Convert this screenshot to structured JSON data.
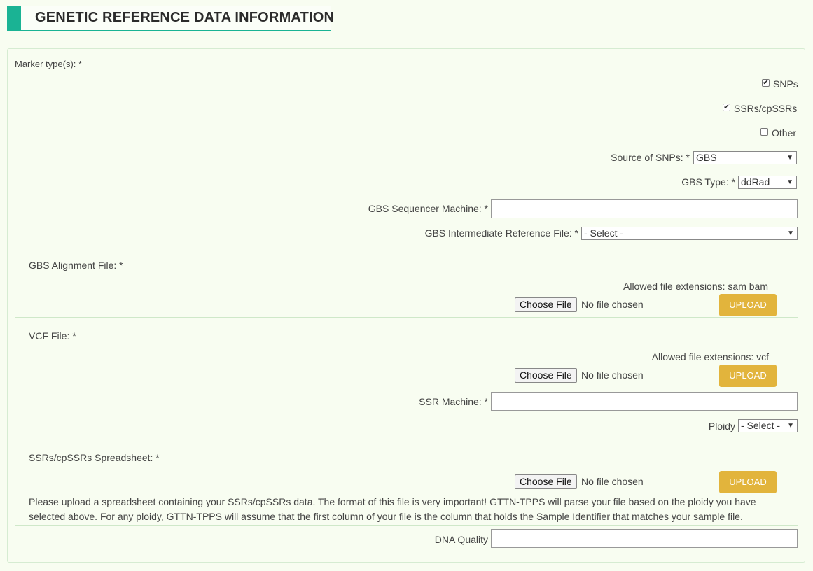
{
  "header": {
    "title": "GENETIC REFERENCE DATA INFORMATION"
  },
  "marker": {
    "label": "Marker type(s): *",
    "options": [
      {
        "label": "SNPs",
        "checked": true
      },
      {
        "label": "SSRs/cpSSRs",
        "checked": true
      },
      {
        "label": "Other",
        "checked": false
      }
    ]
  },
  "snp_source": {
    "label": "Source of SNPs: *",
    "value": "GBS"
  },
  "gbs_type": {
    "label": "GBS Type: *",
    "value": "ddRad"
  },
  "gbs_machine": {
    "label": "GBS Sequencer Machine: *",
    "value": ""
  },
  "gbs_ref": {
    "label": "GBS Intermediate Reference File: *",
    "value": "- Select -"
  },
  "alignment": {
    "label": "GBS Alignment File: *",
    "allowed": "Allowed file extensions: sam bam",
    "choose": "Choose File",
    "status": "No file chosen",
    "upload": "UPLOAD"
  },
  "vcf": {
    "label": "VCF File: *",
    "allowed": "Allowed file extensions: vcf",
    "choose": "Choose File",
    "status": "No file chosen",
    "upload": "UPLOAD"
  },
  "ssr_machine": {
    "label": "SSR Machine: *",
    "value": ""
  },
  "ploidy": {
    "label": "Ploidy",
    "value": "- Select -"
  },
  "ssr_sheet": {
    "label": "SSRs/cpSSRs Spreadsheet: *",
    "choose": "Choose File",
    "status": "No file chosen",
    "upload": "UPLOAD",
    "help": "Please upload a spreadsheet containing your SSRs/cpSSRs data. The format of this file is very important! GTTN-TPPS will parse your file based on the ploidy you have selected above. For any ploidy, GTTN-TPPS will assume that the first column of your file is the column that holds the Sample Identifier that matches your sample file."
  },
  "dna_quality": {
    "label": "DNA Quality",
    "value": ""
  },
  "icons": {
    "dropdown": "▼",
    "check": "✔"
  },
  "colors": {
    "accent": "#1ab394",
    "upload": "#e2b43c",
    "background": "#f8fdf1"
  }
}
